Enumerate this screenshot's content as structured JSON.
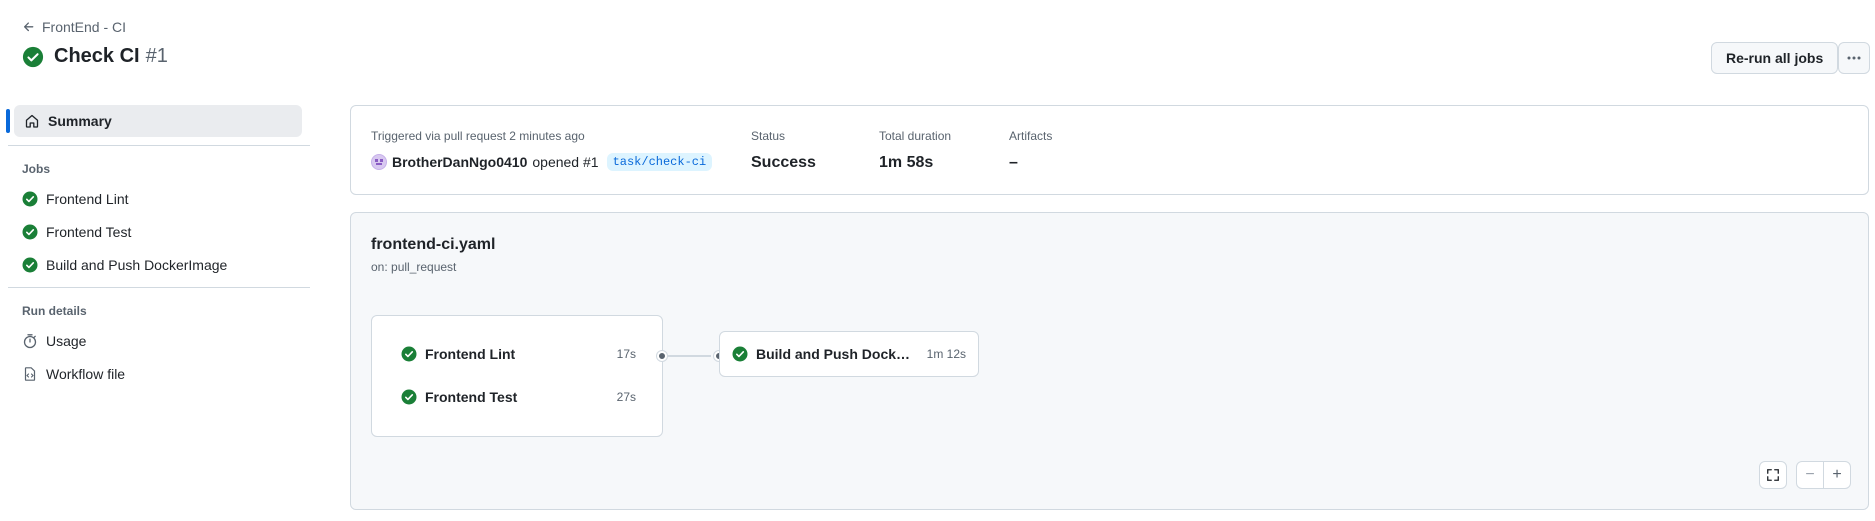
{
  "header": {
    "back_label": "FrontEnd - CI",
    "title": "Check CI",
    "run_number": "#1",
    "rerun_label": "Re-run all jobs",
    "more_label": "···"
  },
  "sidebar": {
    "summary_label": "Summary",
    "jobs_heading": "Jobs",
    "jobs": [
      {
        "label": "Frontend Lint",
        "status": "success"
      },
      {
        "label": "Frontend Test",
        "status": "success"
      },
      {
        "label": "Build and Push DockerImage",
        "status": "success"
      }
    ],
    "run_details_heading": "Run details",
    "run_details": [
      {
        "label": "Usage",
        "icon": "stopwatch-icon"
      },
      {
        "label": "Workflow file",
        "icon": "file-code-icon"
      }
    ]
  },
  "summary": {
    "trigger_label": "Triggered via pull request 2 minutes ago",
    "user": "BrotherDanNgo0410",
    "action": "opened #1",
    "branch": "task/check-ci",
    "status_label": "Status",
    "status_value": "Success",
    "duration_label": "Total duration",
    "duration_value": "1m 58s",
    "artifacts_label": "Artifacts",
    "artifacts_value": "–"
  },
  "workflow": {
    "file": "frontend-ci.yaml",
    "trigger": "on: pull_request",
    "group_jobs": [
      {
        "label": "Frontend Lint",
        "duration": "17s"
      },
      {
        "label": "Frontend Test",
        "duration": "27s"
      }
    ],
    "next_job": {
      "label": "Build and Push DockerImage",
      "duration": "1m 12s"
    },
    "controls": {
      "minus": "−",
      "plus": "+"
    }
  },
  "colors": {
    "success": "#1a7f37",
    "accent": "#0969da",
    "border": "#d1d9e0",
    "muted": "#59636e"
  }
}
